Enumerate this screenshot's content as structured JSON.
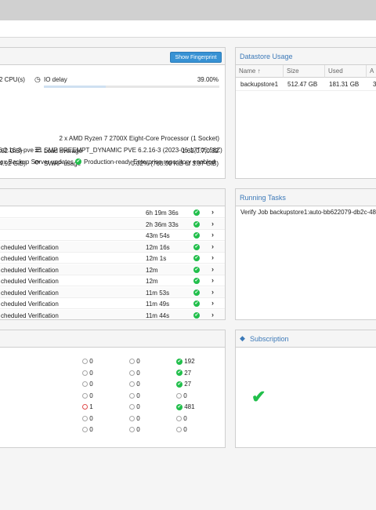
{
  "status": {
    "fingerprint_button": "Show Fingerprint",
    "cpu_suffix": "2 CPU(s)",
    "io_delay_label": "IO delay",
    "io_delay_value": "39.00%",
    "io_delay_fraction": 0.39,
    "mem_suffix": ".82 GiB)",
    "load_label": "Load average",
    "load_value": "1.03,0.7,0.32",
    "swap_prefix": "4.92 GiB)",
    "swap_label": "SWAP usage",
    "swap_value": "0.02% (768.00 KiB of 3.87 GiB)",
    "cpu_model": "2 x AMD Ryzen 7 2700X Eight-Core Processor (1 Socket)",
    "kernel": "6.2.16-3-pve #1 SMP PREEMPT_DYNAMIC PVE 6.2.16-3 (2023-06-17T05:58Z)",
    "updates_text": "ox Backup Server updates",
    "repo_text": "Production-ready Enterprise repository enabled"
  },
  "datastore": {
    "title": "Datastore Usage",
    "columns": [
      "Name ↑",
      "Size",
      "Used",
      "A"
    ],
    "rows": [
      {
        "name": "backupstore1",
        "size": "512.47 GB",
        "used": "181.31 GB",
        "avail": "3"
      }
    ]
  },
  "tasks_list": {
    "rows": [
      {
        "desc": "",
        "duration": "6h 19m 36s"
      },
      {
        "desc": "",
        "duration": "2h 36m 33s"
      },
      {
        "desc": "",
        "duration": "43m 54s"
      },
      {
        "desc": "cheduled Verification",
        "duration": "12m 16s"
      },
      {
        "desc": "cheduled Verification",
        "duration": "12m 1s"
      },
      {
        "desc": "cheduled Verification",
        "duration": "12m"
      },
      {
        "desc": "cheduled Verification",
        "duration": "12m"
      },
      {
        "desc": "cheduled Verification",
        "duration": "11m 53s"
      },
      {
        "desc": "cheduled Verification",
        "duration": "11m 49s"
      },
      {
        "desc": "cheduled Verification",
        "duration": "11m 44s"
      }
    ]
  },
  "running_tasks": {
    "title": "Running Tasks",
    "items": [
      "Verify Job backupstore1:auto-bb622079-db2c-48d"
    ]
  },
  "summary": {
    "rows": [
      {
        "a": "0",
        "b": "0",
        "c": "192",
        "a_state": "grey",
        "c_state": "ok"
      },
      {
        "a": "0",
        "b": "0",
        "c": "27",
        "a_state": "grey",
        "c_state": "ok"
      },
      {
        "a": "0",
        "b": "0",
        "c": "27",
        "a_state": "grey",
        "c_state": "ok"
      },
      {
        "a": "0",
        "b": "0",
        "c": "0",
        "a_state": "grey",
        "c_state": "grey"
      },
      {
        "a": "1",
        "b": "0",
        "c": "481",
        "a_state": "red",
        "c_state": "ok"
      },
      {
        "a": "0",
        "b": "0",
        "c": "0",
        "a_state": "grey",
        "c_state": "grey"
      },
      {
        "a": "0",
        "b": "0",
        "c": "0",
        "a_state": "grey",
        "c_state": "grey"
      }
    ]
  },
  "subscription": {
    "title": "Subscription",
    "icon": "tag-icon"
  },
  "colors": {
    "accent": "#3c79b8",
    "ok": "#21bf4b",
    "error": "#e14d4d"
  }
}
